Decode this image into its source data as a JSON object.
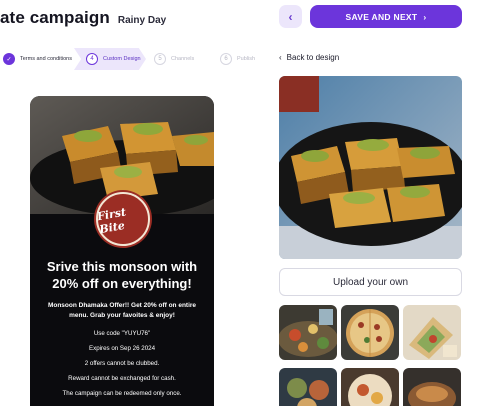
{
  "header": {
    "title": "ate campaign",
    "subtitle": "Rainy Day",
    "back_icon": "chevron-left-icon",
    "save_label": "SAVE AND NEXT",
    "save_icon": "chevron-right-icon"
  },
  "stepper": {
    "steps": [
      {
        "number": "✓",
        "label": "Terms and conditions",
        "state": "done"
      },
      {
        "number": "4",
        "label": "Custom Design",
        "state": "active"
      },
      {
        "number": "5",
        "label": "Channels",
        "state": "pending"
      },
      {
        "number": "6",
        "label": "Publish",
        "state": "pending"
      }
    ]
  },
  "preview": {
    "logo_text": "First Bite",
    "headline": "Srive this monsoon with 20% off on everything!",
    "offer": "Monsoon Dhamaka Offer!! Get 20% off on entire menu. Grab your favoites & enjoy!",
    "lines": [
      "Use code \"YUYU76\"",
      "Expires on Sep 26 2024",
      "2 offers cannot be clubbed.",
      "Reward cannot be exchanged for cash.",
      "The campaign can be redeemed only once."
    ]
  },
  "design_panel": {
    "back_label": "Back to design",
    "upload_label": "Upload your own"
  },
  "colors": {
    "accent": "#6c35db",
    "accent_light": "#ece6fb",
    "card_bg": "#0b0b0e"
  }
}
